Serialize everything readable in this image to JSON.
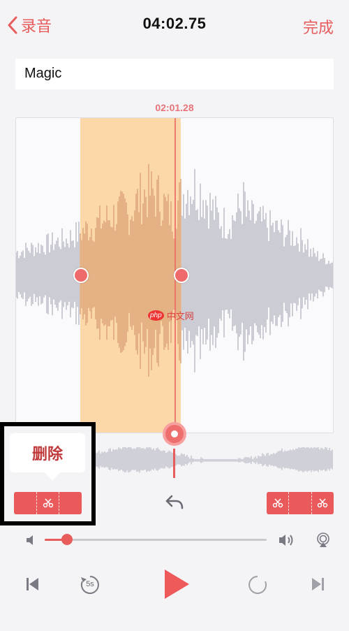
{
  "nav": {
    "back_label": "录音",
    "title": "04:02.75",
    "done_label": "完成"
  },
  "recording": {
    "name": "Magic",
    "playhead_time": "02:01.28"
  },
  "popup": {
    "delete_label": "删除"
  },
  "volume": {
    "level": 0.1
  },
  "transport": {
    "skip_back_label": "5s"
  },
  "watermark": {
    "badge": "php",
    "text": "中文网"
  },
  "colors": {
    "accent": "#e85c5c",
    "selection": "#fcd8a8",
    "waveform": "#b9b9c4",
    "selected_waveform": "#d9a176"
  }
}
